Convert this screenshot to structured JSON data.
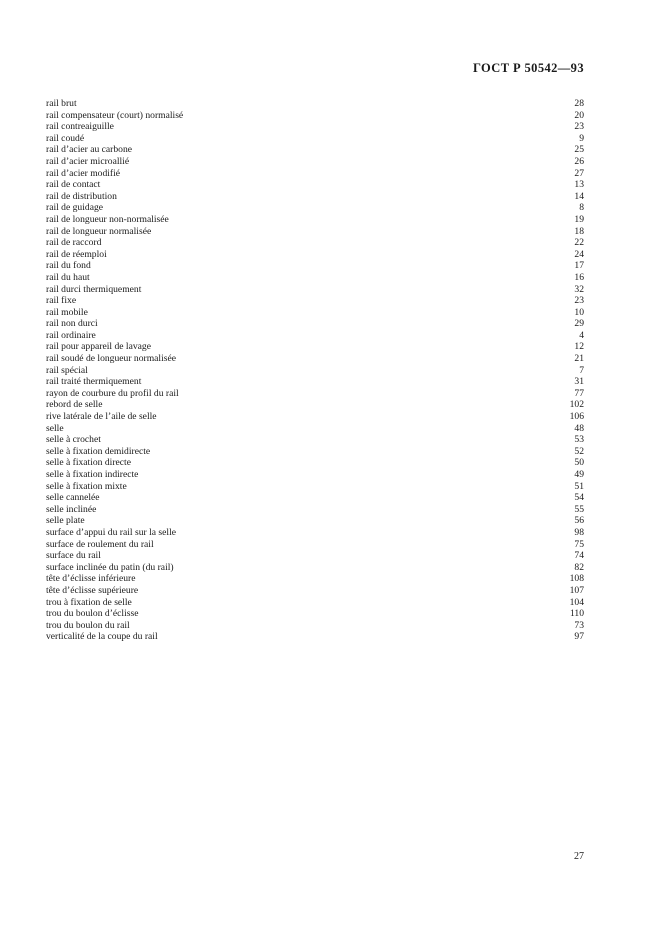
{
  "header": {
    "standard_ref": "ГОСТ Р 50542—93"
  },
  "footer": {
    "page_number": "27"
  },
  "index": {
    "entries": [
      {
        "term": "rail brut",
        "page": "28"
      },
      {
        "term": "rail compensateur (court) normalisé",
        "page": "20"
      },
      {
        "term": "rail contreaiguille",
        "page": "23"
      },
      {
        "term": "rail coudé",
        "page": "9"
      },
      {
        "term": "rail d’acier au carbone",
        "page": "25"
      },
      {
        "term": "rail d’acier microallié",
        "page": "26"
      },
      {
        "term": "rail d’acier modifié",
        "page": "27"
      },
      {
        "term": "rail de contact",
        "page": "13"
      },
      {
        "term": "rail de distribution",
        "page": "14"
      },
      {
        "term": "rail de guidage",
        "page": "8"
      },
      {
        "term": "rail de longueur non-normalisée",
        "page": "19"
      },
      {
        "term": "rail de longueur normalisée",
        "page": "18"
      },
      {
        "term": "rail de raccord",
        "page": "22"
      },
      {
        "term": "rail de réemploi",
        "page": "24"
      },
      {
        "term": "rail du fond",
        "page": "17"
      },
      {
        "term": "rail du haut",
        "page": "16"
      },
      {
        "term": "rail durci thermiquement",
        "page": "32"
      },
      {
        "term": "rail fixe",
        "page": "23"
      },
      {
        "term": "rail mobile",
        "page": "10"
      },
      {
        "term": "rail non durci",
        "page": "29"
      },
      {
        "term": "rail ordinaire",
        "page": "4"
      },
      {
        "term": "rail pour appareil de lavage",
        "page": "12"
      },
      {
        "term": "rail soudé de longueur normalisée",
        "page": "21"
      },
      {
        "term": "rail spécial",
        "page": "7"
      },
      {
        "term": "rail traité thermiquement",
        "page": "31"
      },
      {
        "term": "rayon de courbure du profil du rail",
        "page": "77"
      },
      {
        "term": "rebord de selle",
        "page": "102"
      },
      {
        "term": "rive latérale de l’aile de selle",
        "page": "106"
      },
      {
        "term": "selle",
        "page": "48"
      },
      {
        "term": "selle à crochet",
        "page": "53"
      },
      {
        "term": "selle à fixation demidirecte",
        "page": "52"
      },
      {
        "term": "selle à fixation directe",
        "page": "50"
      },
      {
        "term": "selle à fixation indirecte",
        "page": "49"
      },
      {
        "term": "selle à fixation mixte",
        "page": "51"
      },
      {
        "term": "selle cannelée",
        "page": "54"
      },
      {
        "term": "selle inclinée",
        "page": "55"
      },
      {
        "term": "selle plate",
        "page": "56"
      },
      {
        "term": "surface d’appui du rail sur la selle",
        "page": "98"
      },
      {
        "term": "surface de roulement du rail",
        "page": "75"
      },
      {
        "term": "surface du rail",
        "page": "74"
      },
      {
        "term": "surface inclinée du patin (du rail)",
        "page": "82"
      },
      {
        "term": "tête d’éclisse inférieure",
        "page": "108"
      },
      {
        "term": "tête d’éclisse supérieure",
        "page": "107"
      },
      {
        "term": "trou à fixation de selle",
        "page": "104"
      },
      {
        "term": "trou du boulon d’éclisse",
        "page": "110"
      },
      {
        "term": "trou du boulon du rail",
        "page": "73"
      },
      {
        "term": "verticalité de la coupe du rail",
        "page": "97"
      }
    ]
  }
}
